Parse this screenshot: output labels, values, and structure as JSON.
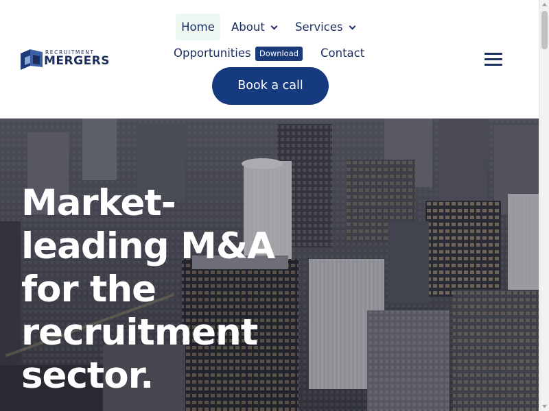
{
  "brand": {
    "logo_small": "RECRUITMENT",
    "logo_big": "MERGERS",
    "colors": {
      "primary": "#163a7e",
      "text": "#1b2e5e",
      "home_highlight": "#eef7f2"
    }
  },
  "nav": {
    "home": "Home",
    "about": "About",
    "services": "Services",
    "opportunities": "Opportunities",
    "download_badge": "Download",
    "contact": "Contact",
    "cta": "Book a call",
    "menu_icon": "hamburger-menu-icon"
  },
  "hero": {
    "title": "Market-leading M&A for the recruitment sector."
  }
}
